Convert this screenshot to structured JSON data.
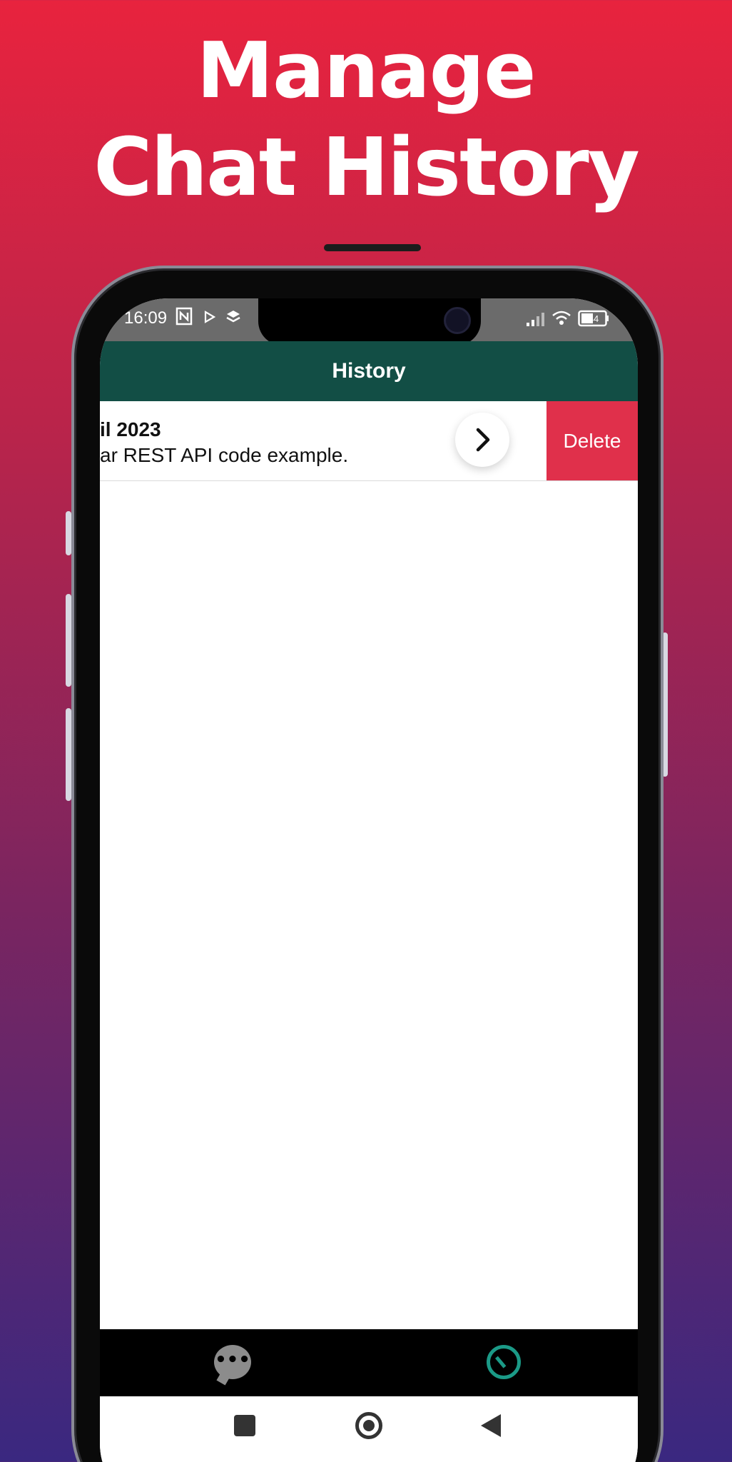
{
  "promo": {
    "headline_line1": "Manage",
    "headline_line2": "Chat History"
  },
  "statusbar": {
    "time": "16:09",
    "battery": "44",
    "icons": [
      "nfc-icon",
      "play-store-icon",
      "layers-icon",
      "signal-icon",
      "wifi-icon",
      "battery-icon"
    ]
  },
  "appbar": {
    "title": "History"
  },
  "history": {
    "items": [
      {
        "date": "il 2023",
        "preview": "ar REST API code example.",
        "open_icon": "chevron-right-icon",
        "delete_label": "Delete"
      }
    ]
  },
  "bottom_nav": {
    "items": [
      {
        "icon": "chat-bubble-icon",
        "active": false
      },
      {
        "icon": "history-clock-icon",
        "active": true
      }
    ]
  },
  "system_nav": {
    "icons": [
      "recent-apps-icon",
      "home-icon",
      "back-icon"
    ]
  },
  "colors": {
    "appbar": "#124e45",
    "delete": "#e0304b",
    "active_nav": "#1b9a87",
    "gradient_top": "#e8233e",
    "gradient_bottom": "#3a2880"
  }
}
